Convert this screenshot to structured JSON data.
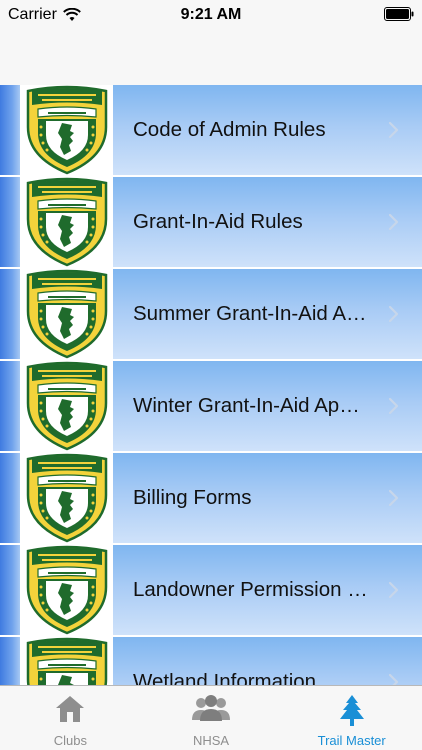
{
  "status_bar": {
    "carrier": "Carrier",
    "time": "9:21 AM"
  },
  "list": {
    "items": [
      {
        "label": "Code of Admin Rules"
      },
      {
        "label": "Grant-In-Aid Rules"
      },
      {
        "label": "Summer Grant-In-Aid Application"
      },
      {
        "label": "Winter Grant-In-Aid Application"
      },
      {
        "label": "Billing Forms"
      },
      {
        "label": "Landowner Permission Form"
      },
      {
        "label": "Wetland Information"
      }
    ],
    "logo": {
      "text_top": "DEPARTMENT OF RESOURCES & ECONOMIC DEVELOPMENT",
      "text_mid": "NEW HAMPSHIRE",
      "text_bottom": "TRAILS BUREAU",
      "colors": {
        "outer": "#f3d33b",
        "ring": "#1f6b2c",
        "face": "#ffffff"
      }
    }
  },
  "tab_bar": {
    "tabs": [
      {
        "label": "Clubs",
        "icon": "house-icon",
        "active": false
      },
      {
        "label": "NHSA",
        "icon": "people-icon",
        "active": false
      },
      {
        "label": "Trail Master",
        "icon": "tree-icon",
        "active": true
      }
    ],
    "active_color": "#1a8fd6",
    "inactive_color": "#8e8e8e"
  }
}
